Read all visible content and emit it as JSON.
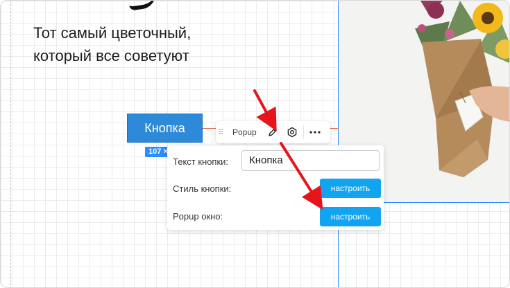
{
  "hero": {
    "line1": "Тот самый цветочный,",
    "line2": "который все советуют"
  },
  "element": {
    "button_label": "Кнопка",
    "size_badge": "107 ×"
  },
  "toolbar": {
    "type_label": "Popup",
    "icons": [
      "drag-handle-icon",
      "pencil-icon",
      "settings-icon",
      "more-icon"
    ]
  },
  "panel": {
    "text_label": "Текст кнопки:",
    "text_value": "Кнопка",
    "style_label": "Стиль кнопки:",
    "style_button": "настроить",
    "popup_label": "Popup окно:",
    "popup_button": "настроить"
  },
  "colors": {
    "accent": "#2d8cff",
    "element_button": "#2d8ad9",
    "config_button": "#12a4f1",
    "annotation": "#e8141c"
  }
}
